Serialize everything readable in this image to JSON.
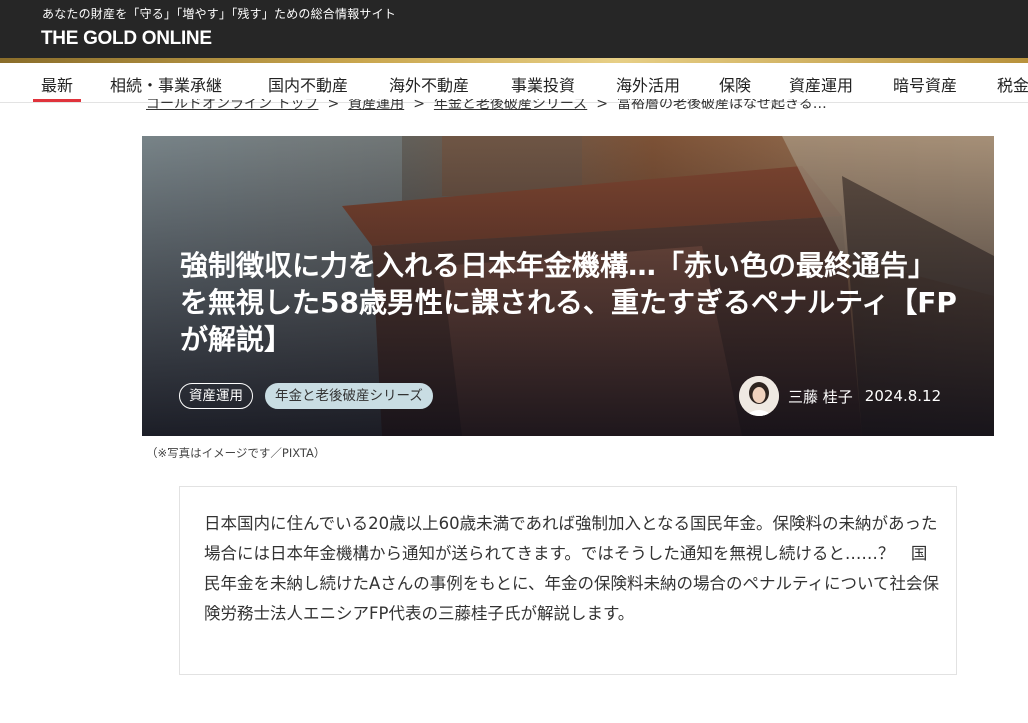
{
  "header": {
    "tagline": "あなたの財産を「守る」「増やす」「残す」ための総合情報サイト",
    "logo": "THE GOLD ONLINE"
  },
  "nav": {
    "items": [
      {
        "label": "最新",
        "active": true
      },
      {
        "label": "相続・事業承継"
      },
      {
        "label": "国内不動産"
      },
      {
        "label": "海外不動産"
      },
      {
        "label": "事業投資"
      },
      {
        "label": "海外活用"
      },
      {
        "label": "保険"
      },
      {
        "label": "資産運用"
      },
      {
        "label": "暗号資産"
      },
      {
        "label": "税金"
      }
    ]
  },
  "breadcrumb": {
    "items": [
      "ゴールドオンライン トップ",
      "資産運用",
      "年金と老後破産シリーズ",
      "富裕層の老後破産はなぜ起きる…"
    ],
    "separator": ">"
  },
  "article": {
    "title": "強制徴収に力を入れる日本年金機構…「赤い色の最終通告」を無視した58歳男性に課される、重たすぎるペナルティ【FPが解説】",
    "tags": [
      "資産運用",
      "年金と老後破産シリーズ"
    ],
    "author": "三藤 桂子",
    "date": "2024.8.12",
    "image_caption": "（※写真はイメージです／PIXTA）",
    "lead": "日本国内に住んでいる20歳以上60歳未満であれば強制加入となる国民年金。保険料の未納があった場合には日本年金機構から通知が送られてきます。ではそうした通知を無視し続けると……？　国民年金を未納し続けたAさんの事例をもとに、年金の保険料未納の場合のペナルティについて社会保険労務士法人エニシアFP代表の三藤桂子氏が解説します。"
  },
  "colors": {
    "header_bg": "#262626",
    "gold_accent": "#c9a64e",
    "active_underline": "#e0333c",
    "tag_filled_bg": "#c9dde3"
  }
}
